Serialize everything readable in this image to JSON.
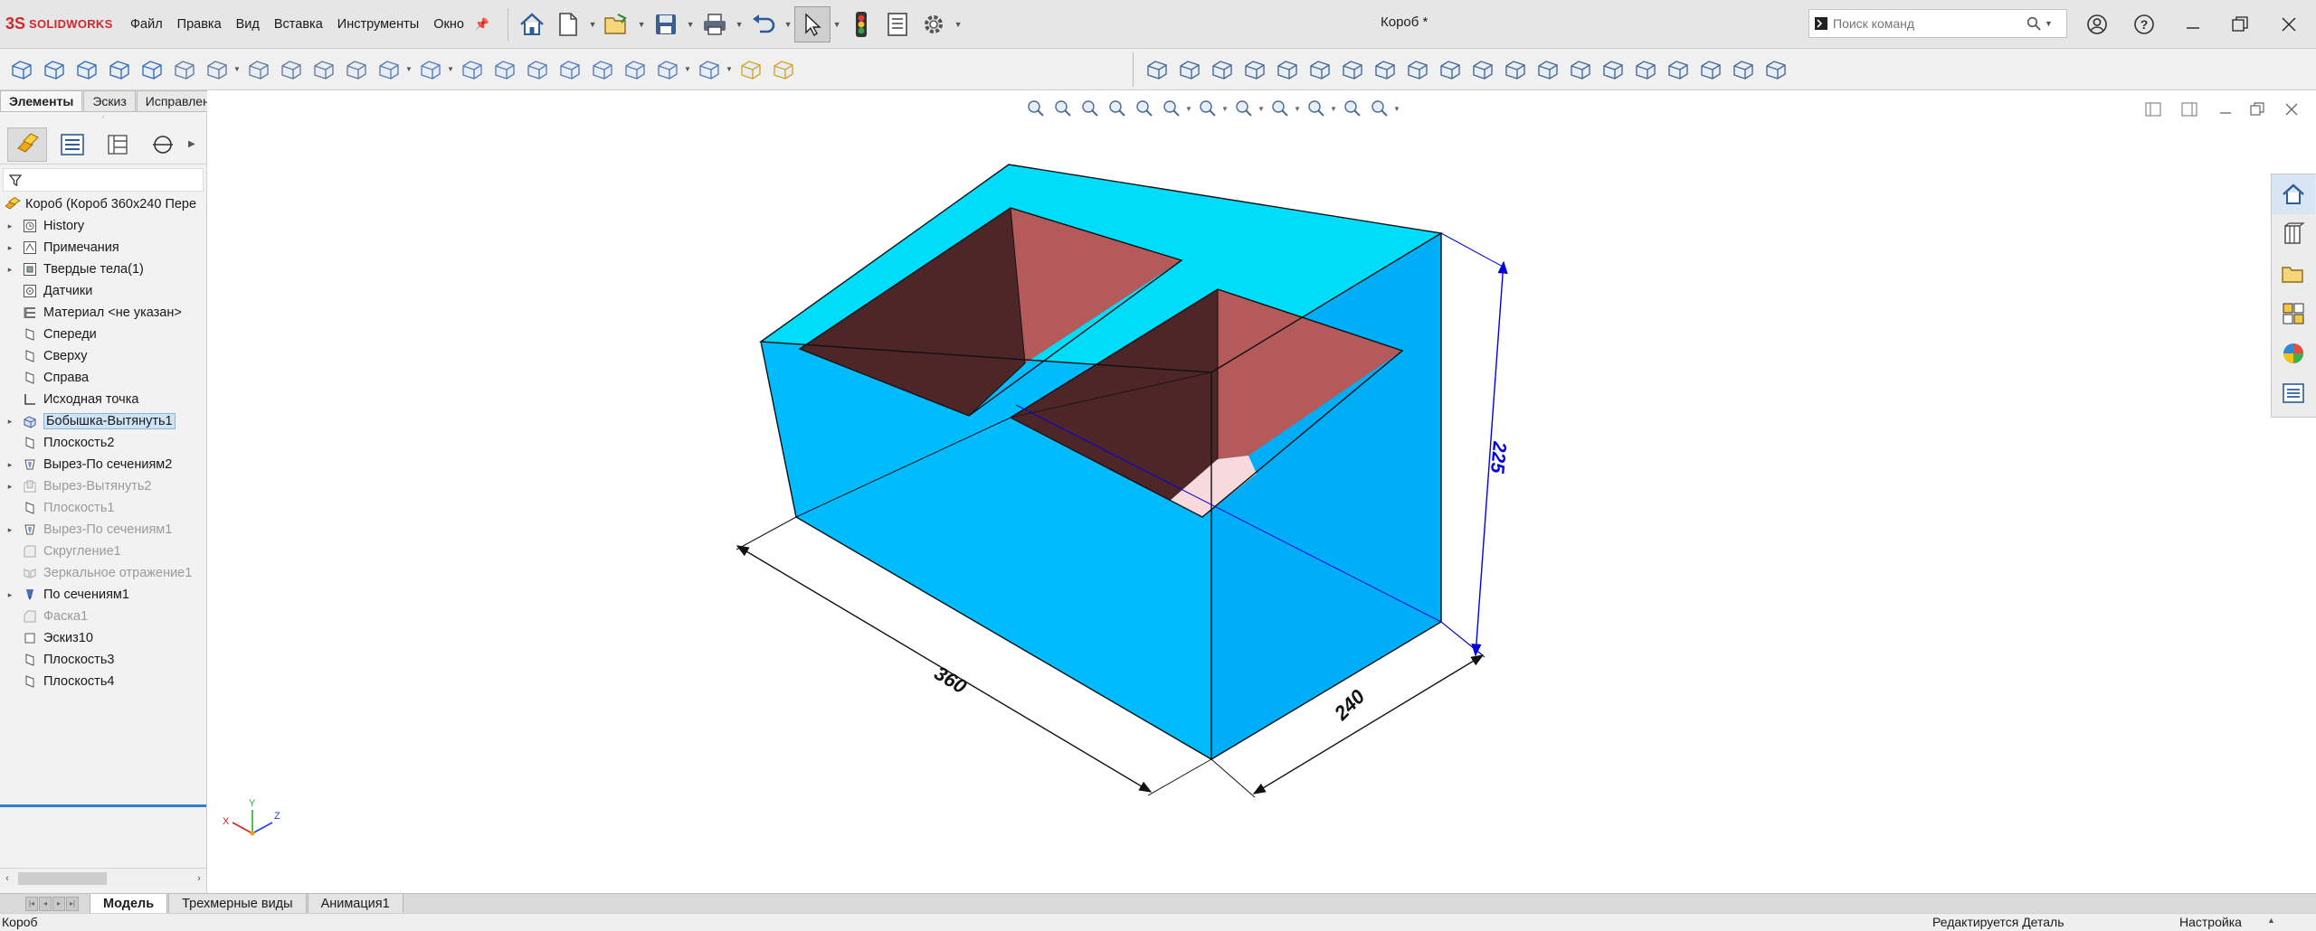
{
  "app": {
    "logo_text": "SOLIDWORKS",
    "logo_mark": "3S",
    "document_title": "Короб *"
  },
  "menu": [
    "Файл",
    "Правка",
    "Вид",
    "Вставка",
    "Инструменты",
    "Окно"
  ],
  "search": {
    "placeholder": "Поиск команд"
  },
  "left_tabs": [
    {
      "label": "Элементы",
      "active": true
    },
    {
      "label": "Эскиз",
      "active": false
    },
    {
      "label": "Исправление",
      "active": false
    }
  ],
  "tree": {
    "root": "Короб  (Короб 360х240 Пере",
    "items": [
      {
        "label": "History",
        "expandable": true,
        "icon": "history-icon",
        "state": "normal"
      },
      {
        "label": "Примечания",
        "expandable": true,
        "icon": "annotations-icon",
        "state": "normal"
      },
      {
        "label": "Твердые тела(1)",
        "expandable": true,
        "icon": "solid-bodies-icon",
        "state": "normal"
      },
      {
        "label": "Датчики",
        "expandable": false,
        "icon": "sensors-icon",
        "state": "normal"
      },
      {
        "label": "Материал <не указан>",
        "expandable": false,
        "icon": "material-icon",
        "state": "normal"
      },
      {
        "label": "Спереди",
        "expandable": false,
        "icon": "plane-icon",
        "state": "normal"
      },
      {
        "label": "Сверху",
        "expandable": false,
        "icon": "plane-icon",
        "state": "normal"
      },
      {
        "label": "Справа",
        "expandable": false,
        "icon": "plane-icon",
        "state": "normal"
      },
      {
        "label": "Исходная точка",
        "expandable": false,
        "icon": "origin-icon",
        "state": "normal"
      },
      {
        "label": "Бобышка-Вытянуть1",
        "expandable": true,
        "icon": "extrude-boss-icon",
        "state": "selected"
      },
      {
        "label": "Плоскость2",
        "expandable": false,
        "icon": "plane-icon",
        "state": "normal"
      },
      {
        "label": "Вырез-По сечениям2",
        "expandable": true,
        "icon": "loft-cut-icon",
        "state": "normal"
      },
      {
        "label": "Вырез-Вытянуть2",
        "expandable": true,
        "icon": "extrude-cut-icon",
        "state": "dim"
      },
      {
        "label": "Плоскость1",
        "expandable": false,
        "icon": "plane-icon",
        "state": "dim"
      },
      {
        "label": "Вырез-По сечениям1",
        "expandable": true,
        "icon": "loft-cut-icon",
        "state": "dim"
      },
      {
        "label": "Скругление1",
        "expandable": false,
        "icon": "fillet-icon",
        "state": "dim"
      },
      {
        "label": "Зеркальное отражение1",
        "expandable": false,
        "icon": "mirror-icon",
        "state": "dim"
      },
      {
        "label": "По сечениям1",
        "expandable": true,
        "icon": "loft-icon",
        "state": "normal"
      },
      {
        "label": "Фаска1",
        "expandable": false,
        "icon": "chamfer-icon",
        "state": "dim"
      },
      {
        "label": "Эскиз10",
        "expandable": false,
        "icon": "sketch-icon",
        "state": "normal"
      },
      {
        "label": "Плоскость3",
        "expandable": false,
        "icon": "plane-icon",
        "state": "normal"
      },
      {
        "label": "Плоскость4",
        "expandable": false,
        "icon": "plane-icon",
        "state": "normal"
      }
    ]
  },
  "model": {
    "dimensions": {
      "length": "360",
      "width": "240",
      "height": "225"
    },
    "triad": {
      "x": "X",
      "y": "Y",
      "z": "Z"
    },
    "colors": {
      "face_top": "#00ddfa",
      "face_front": "#00bcff",
      "face_right": "#00aef7",
      "inner_dark": "#4e2628",
      "inner_light": "#b55a5a",
      "inner_floor": "#f8dadd",
      "dimension_black": "#111111",
      "dimension_blue": "#0000e0"
    }
  },
  "bottom_tabs": [
    {
      "label": "Модель",
      "active": true
    },
    {
      "label": "Трехмерные виды",
      "active": false
    },
    {
      "label": "Анимация1",
      "active": false
    }
  ],
  "status": {
    "left": "Короб",
    "editing": "Редактируется Деталь",
    "units": "Настройка"
  }
}
